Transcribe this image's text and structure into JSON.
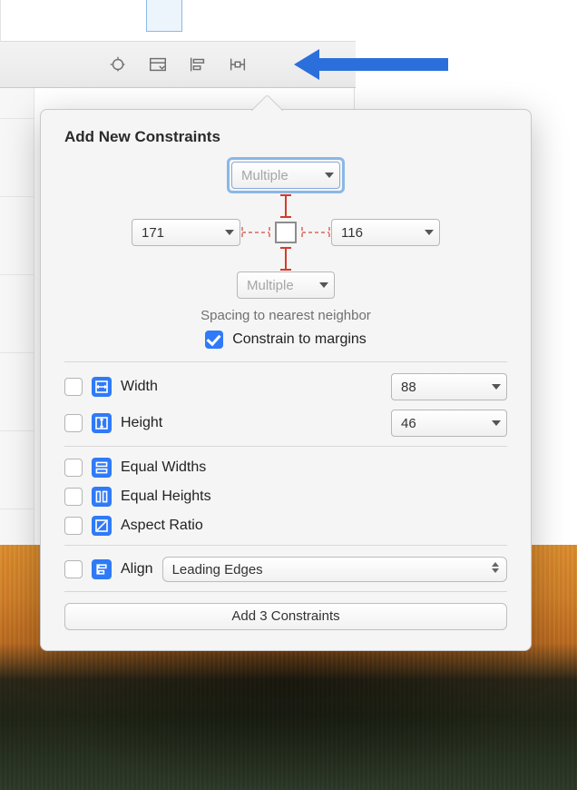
{
  "toolbar_icons": [
    "update-frames-icon",
    "embed-in-icon",
    "align-icon",
    "add-constraints-icon"
  ],
  "popover": {
    "title": "Add New Constraints",
    "spacing": {
      "top": "Multiple",
      "left": "171",
      "right": "116",
      "bottom": "Multiple",
      "caption": "Spacing to nearest neighbor",
      "constrain_margins_label": "Constrain to margins",
      "constrain_margins_checked": true
    },
    "size": {
      "width_label": "Width",
      "width_value": "88",
      "height_label": "Height",
      "height_value": "46"
    },
    "equal": {
      "equal_widths_label": "Equal Widths",
      "equal_heights_label": "Equal Heights",
      "aspect_ratio_label": "Aspect Ratio"
    },
    "align": {
      "label": "Align",
      "value": "Leading Edges"
    },
    "submit_label": "Add 3 Constraints"
  },
  "brace_glyph": "{}"
}
